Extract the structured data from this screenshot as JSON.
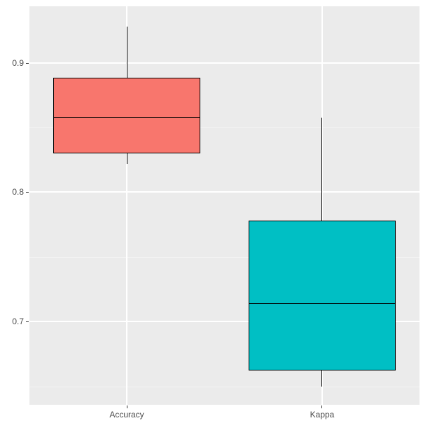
{
  "chart_data": {
    "type": "boxplot",
    "categories": [
      "Accuracy",
      "Kappa"
    ],
    "series": [
      {
        "name": "Accuracy",
        "lower_whisker": 0.822,
        "q1": 0.83,
        "median": 0.858,
        "q3": 0.888,
        "upper_whisker": 0.928,
        "fill": "#f8766d"
      },
      {
        "name": "Kappa",
        "lower_whisker": 0.65,
        "q1": 0.662,
        "median": 0.714,
        "q3": 0.775,
        "upper_whisker": 0.858,
        "fill": "#00bfc4"
      }
    ],
    "title": "",
    "xlabel": "",
    "ylabel": "",
    "ylim": [
      0.636,
      0.944
    ],
    "y_ticks": [
      0.7,
      0.8,
      0.9
    ],
    "y_minor": [
      0.65,
      0.75,
      0.85
    ],
    "panel_background": "#ebebeb",
    "grid_major_color": "#ffffff"
  },
  "axis": {
    "y": {
      "t0": "0.7",
      "t1": "0.8",
      "t2": "0.9"
    },
    "x": {
      "c0": "Accuracy",
      "c1": "Kappa"
    }
  }
}
